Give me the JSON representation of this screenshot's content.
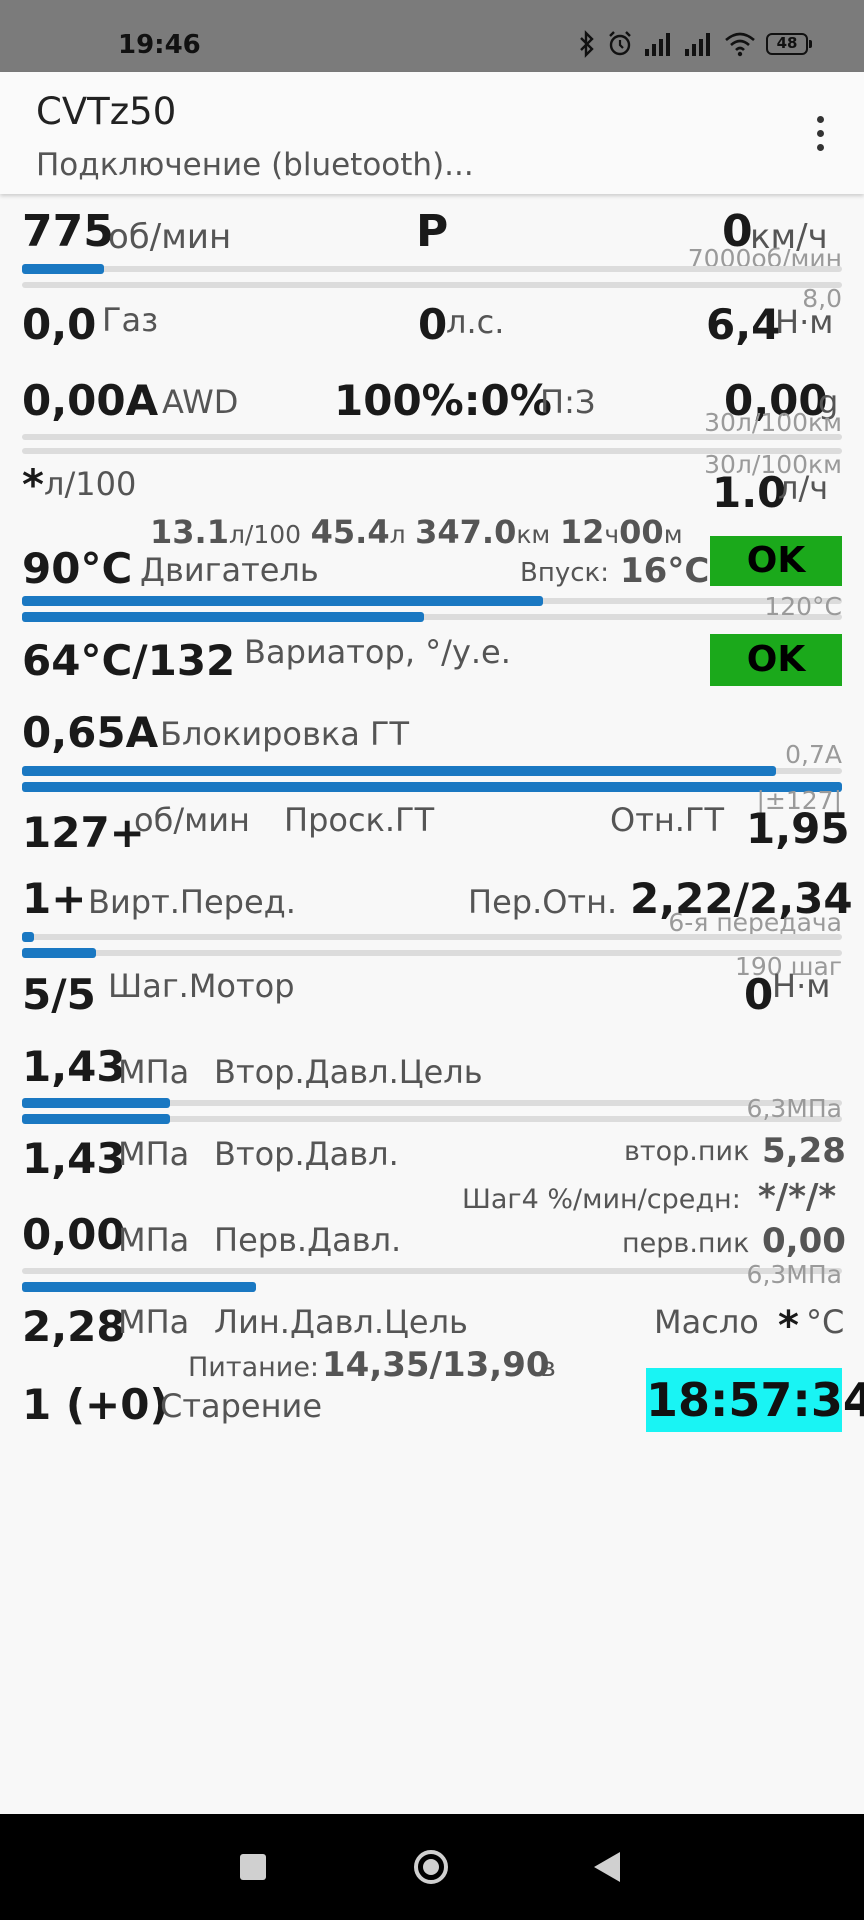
{
  "status": {
    "time": "19:46",
    "battery": "48"
  },
  "app": {
    "title": "CVTz50",
    "subtitle": "Подключение (bluetooth)..."
  },
  "rows": {
    "rpm": {
      "value": "775",
      "unit": "об/мин",
      "gear": "P",
      "speed": "0",
      "speed_unit": "км/ч",
      "scale": "7000об/мин",
      "fraction": 0.1
    },
    "throttle": {
      "scale_top": "8,0",
      "value": "0,0",
      "label": "Газ",
      "hp": "0",
      "hp_unit": "л.с.",
      "torque": "6,4",
      "torque_unit": "Н·м"
    },
    "awd": {
      "value": "0,00A",
      "label": "AWD",
      "ratio": "100%:0%",
      "ratio_label": "П:З",
      "g": "0,00",
      "g_unit": "g",
      "scale1": "30л/100км",
      "scale2": "30л/100км"
    },
    "fuel": {
      "star": "*",
      "unit": "л/100",
      "value": "1.0",
      "value_unit": "л/ч"
    },
    "trip": {
      "avg": "13.1",
      "avg_unit": "л/100",
      "fuel": "45.4",
      "fuel_unit": "л",
      "dist": "347.0",
      "dist_unit": "км",
      "hours": "12",
      "h_unit": "ч",
      "minutes": "00",
      "m_unit": "м"
    },
    "engine": {
      "value": "90°C",
      "label": "Двигатель",
      "intake_label": "Впуск:",
      "intake": "16°C",
      "status": "OK",
      "scale": "120°C",
      "fraction1": 0.635,
      "fraction2": 0.49
    },
    "cvt": {
      "value": "64°C/132",
      "label": "Вариатор, °/у.е.",
      "status": "OK"
    },
    "lockup": {
      "value": "0,65A",
      "label": "Блокировка ГТ",
      "scale": "0,7A",
      "fraction1": 0.92,
      "fraction2": 1.0
    },
    "slip": {
      "scale": "|±127|",
      "value": "127+",
      "unit": "об/мин",
      "label": "Проск.ГТ",
      "ratio_label": "Отн.ГТ",
      "ratio": "1,95"
    },
    "vgear": {
      "value": "1+",
      "label": "Вирт.Перед.",
      "ratio_label": "Пер.Отн.",
      "ratio": "2,22/2,34",
      "scale": "6-я передача",
      "fraction1": 0.015,
      "fraction2": 0.09
    },
    "step": {
      "scale": "190 шаг",
      "value": "5/5",
      "label": "Шаг.Мотор",
      "torque": "0",
      "torque_unit": "Н·м"
    },
    "sec_target": {
      "value": "1,43",
      "unit": "МПа",
      "label": "Втор.Давл.Цель",
      "fraction1": 0.18,
      "fraction2": 0.18
    },
    "sec": {
      "scale": "6,3МПа",
      "value": "1,43",
      "unit": "МПа",
      "label": "Втор.Давл.",
      "peak_label": "втор.пик",
      "peak": "5,28"
    },
    "step4": {
      "label": "Шаг4 %/мин/средн:",
      "value": "*/*/*"
    },
    "prim": {
      "value": "0,00",
      "unit": "МПа",
      "label": "Перв.Давл.",
      "peak_label": "перв.пик",
      "peak": "0,00",
      "scale": "6,3МПа",
      "fraction": 0.285
    },
    "line": {
      "value": "2,28",
      "unit": "МПа",
      "label": "Лин.Давл.Цель",
      "oil_label": "Масло",
      "oil_value": "*",
      "oil_unit": "°C"
    },
    "power": {
      "label": "Питание:",
      "value": "14,35/13,90",
      "unit": "в"
    },
    "aging": {
      "value": "1 (+0)",
      "label": "Старение",
      "clock": "18:57:34"
    }
  }
}
